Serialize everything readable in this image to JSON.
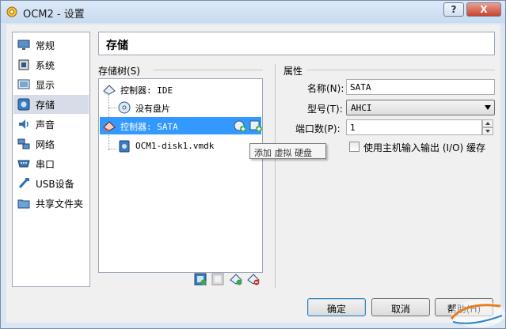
{
  "window": {
    "title": "OCM2 - 设置",
    "help_label": "?",
    "close_label": "X"
  },
  "nav": {
    "items": [
      {
        "label": "常规",
        "icon": "monitor-icon"
      },
      {
        "label": "系统",
        "icon": "chip-icon"
      },
      {
        "label": "显示",
        "icon": "display-icon"
      },
      {
        "label": "存储",
        "icon": "storage-icon"
      },
      {
        "label": "声音",
        "icon": "speaker-icon"
      },
      {
        "label": "网络",
        "icon": "network-icon"
      },
      {
        "label": "串口",
        "icon": "serial-port-icon"
      },
      {
        "label": "USB设备",
        "icon": "usb-icon"
      },
      {
        "label": "共享文件夹",
        "icon": "folder-icon"
      }
    ],
    "selected_index": 3
  },
  "page": {
    "title": "存储"
  },
  "storage_tree": {
    "group_label": "存储树(S)",
    "controller_ide": "控制器: IDE",
    "no_disk": "没有盘片",
    "controller_sata": "控制器: SATA",
    "disk": "OCM1-disk1.vmdk",
    "tooltip": "添加 虚拟 硬盘"
  },
  "attributes": {
    "group_label": "属性",
    "name_label": "名称(N):",
    "name_value": "SATA",
    "type_label": "型号(T):",
    "type_value": "AHCI",
    "port_label": "端口数(P):",
    "port_value": "1",
    "host_io_cache_label": "使用主机输入输出 (I/O) 缓存",
    "host_io_cache_checked": false
  },
  "buttons": {
    "ok": "确定",
    "cancel": "取消",
    "help": "帮助(H)"
  },
  "colors": {
    "selection": "#3399ff",
    "accent_green": "#3aa655"
  }
}
